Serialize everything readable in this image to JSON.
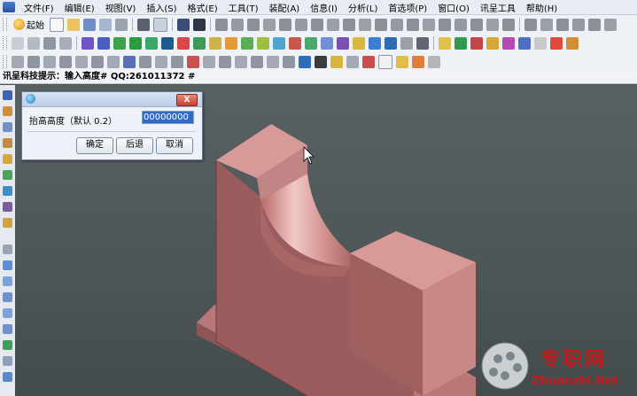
{
  "menu": {
    "items": [
      {
        "label": "文件(F)"
      },
      {
        "label": "编辑(E)"
      },
      {
        "label": "视图(V)"
      },
      {
        "label": "插入(S)"
      },
      {
        "label": "格式(E)"
      },
      {
        "label": "工具(T)"
      },
      {
        "label": "装配(A)"
      },
      {
        "label": "信息(I)"
      },
      {
        "label": "分析(L)"
      },
      {
        "label": "首选项(P)"
      },
      {
        "label": "窗口(O)"
      },
      {
        "label": "讯呈工具"
      },
      {
        "label": "帮助(H)"
      }
    ]
  },
  "toolbar": {
    "start_label": "起始"
  },
  "status": {
    "text": "讯呈科技提示：输入高度# QQ:261011372 #"
  },
  "dialog": {
    "close_label": "X",
    "prompt": "抬高高度（默认 0.2）",
    "input_value": "00000000",
    "ok_label": "确定",
    "back_label": "后退",
    "cancel_label": "取消"
  },
  "watermark": {
    "text": "专职网",
    "sub": "Zhuanzhi.Net"
  },
  "colors": {
    "model": "#c98080",
    "model_face_top": "#d99a98",
    "model_side": "#8e5454",
    "viewport": "#4d5557"
  }
}
